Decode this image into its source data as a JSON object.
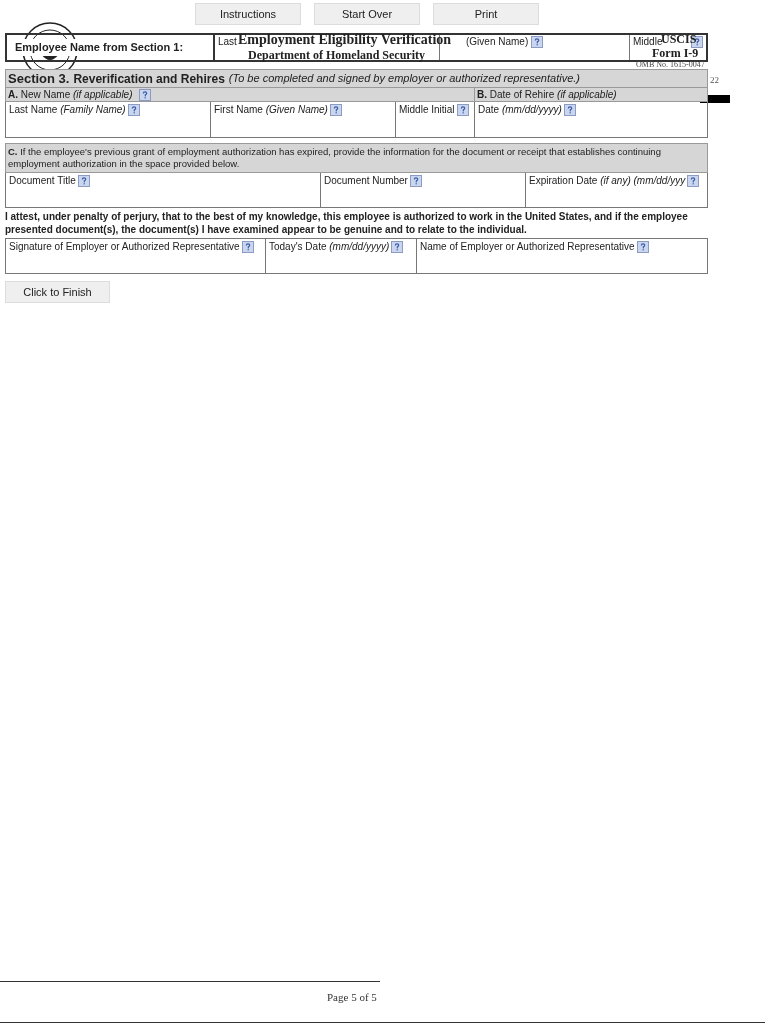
{
  "toolbar": [
    {
      "label": "Instructions"
    },
    {
      "label": "Start Over"
    },
    {
      "label": "Print"
    }
  ],
  "page_header": {
    "title": "Employment Eligibility Verification",
    "department": "Department of Homeland Security",
    "agency": "USCIS",
    "form": "Form I-9",
    "omb": "OMB No. 1615-0047",
    "expires": "22"
  },
  "employee_row": {
    "label": "Employee Name from Section 1:",
    "fields": [
      {
        "label": "Last"
      },
      {
        "label": "(Given Name)",
        "help": true
      },
      {
        "label": "Middle",
        "help": true
      }
    ]
  },
  "section": {
    "number": "Section 3.",
    "title": "Reverification and Rehires",
    "note": "(To be completed and signed by employer or authorized representative.)"
  },
  "part_a": {
    "letter": "A.",
    "label": "New Name *(if applicable)*",
    "help": true,
    "fields": [
      {
        "label": "Last Name *(Family Name)*",
        "help": true
      },
      {
        "label": "First Name *(Given Name)*",
        "help": true
      },
      {
        "label": "Middle Initial",
        "help": true
      }
    ]
  },
  "part_b": {
    "letter": "B.",
    "label": "Date of Rehire *(if applicable)*",
    "fields": [
      {
        "label": "Date *(mm/dd/yyyy)*",
        "help": true
      }
    ]
  },
  "part_c": {
    "letter": "C.",
    "text": "If the employee's previous grant of employment authorization has expired, provide the information for the document or receipt that establishes continuing employment authorization in the space provided below.",
    "fields": [
      {
        "label": "Document Title",
        "help": true
      },
      {
        "label": "Document Number",
        "help": true
      },
      {
        "label": "Expiration Date *(if any) (mm/dd/yyy*",
        "help": true
      }
    ]
  },
  "attestation": "I attest, under penalty of perjury, that to the best of my knowledge, this employee is authorized to work in the United States, and if the employee presented document(s), the document(s) I have examined appear to be genuine and to relate to the individual.",
  "signature_fields": [
    {
      "label": "Signature of Employer or Authorized Representative",
      "help": true
    },
    {
      "label": "Today's Date *(mm/dd/yyyy)*",
      "help": true
    },
    {
      "label": "Name of Employer or Authorized Representative",
      "help": true
    }
  ],
  "finish_button": "Click to Finish",
  "footer": {
    "page": "Page 5 of 5"
  }
}
